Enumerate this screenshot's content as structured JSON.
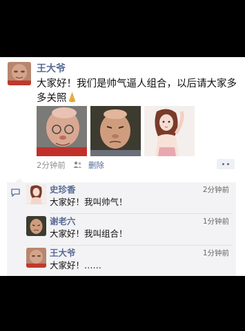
{
  "post": {
    "author": "王大爷",
    "text": "大家好！我们是帅气逼人组合，以后请大家多多关照",
    "emoji_icon": "folded-hands-emoji",
    "photos": [
      {
        "subject": "older bald man, close-up"
      },
      {
        "subject": "older man frowning"
      },
      {
        "subject": "illustrated young woman"
      }
    ],
    "time": "2分钟前",
    "delete_label": "删除",
    "more_icon": "two-dots-icon"
  },
  "comments": [
    {
      "author": "史珍香",
      "time": "2分钟前",
      "text": "大家好！我叫帅气！"
    },
    {
      "author": "谢老六",
      "time": "1分钟前",
      "text": "大家好！我叫组合！"
    },
    {
      "author": "王大爷",
      "time": "1分钟前",
      "text": "大家好！……"
    }
  ],
  "colors": {
    "link_blue": "#576b95",
    "comment_bg": "#f3f3f5",
    "letterbox": "#000000"
  }
}
